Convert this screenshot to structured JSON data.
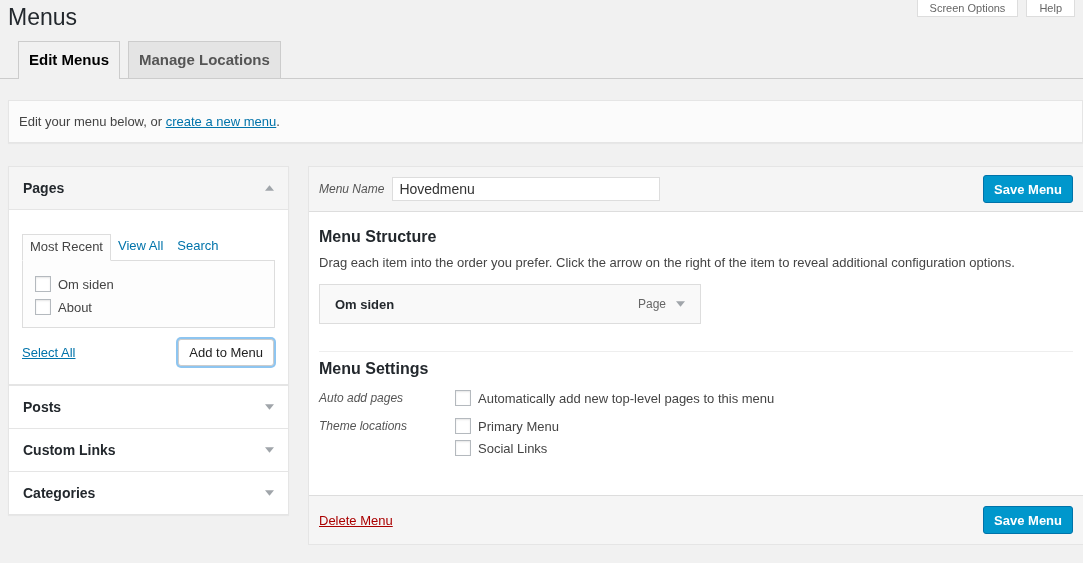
{
  "page_title": "Menus",
  "header_buttons": [
    "Screen Options",
    "Help"
  ],
  "tabs": [
    {
      "label": "Edit Menus",
      "selected": true
    },
    {
      "label": "Manage Locations",
      "selected": false
    }
  ],
  "notice": {
    "text": "Edit your menu below, or ",
    "link": "create a new menu",
    "end": "."
  },
  "sidebar": [
    {
      "title": "Pages",
      "expanded": true,
      "tabs": [
        {
          "label": "Most Recent",
          "selected": true
        },
        {
          "label": "View All",
          "selected": false
        },
        {
          "label": "Search",
          "selected": false
        }
      ],
      "items": [
        {
          "label": "Om siden",
          "checked": false
        },
        {
          "label": "About",
          "checked": false
        }
      ],
      "select_all": "Select All",
      "add_button": "Add to Menu"
    },
    {
      "title": "Posts",
      "expanded": false
    },
    {
      "title": "Custom Links",
      "expanded": false
    },
    {
      "title": "Categories",
      "expanded": false
    }
  ],
  "menu": {
    "name_label": "Menu Name",
    "name_value": "Hovedmenu",
    "save_button": "Save Menu",
    "structure_title": "Menu Structure",
    "structure_help": "Drag each item into the order you prefer. Click the arrow on the right of the item to reveal additional configuration options.",
    "items": [
      {
        "title": "Om siden",
        "type": "Page"
      }
    ],
    "settings_title": "Menu Settings",
    "settings": [
      {
        "label": "Auto add pages",
        "options": [
          {
            "label": "Automatically add new top-level pages to this menu",
            "checked": false
          }
        ]
      },
      {
        "label": "Theme locations",
        "options": [
          {
            "label": "Primary Menu",
            "checked": false
          },
          {
            "label": "Social Links",
            "checked": false
          }
        ]
      }
    ],
    "delete_link": "Delete Menu",
    "footer_save_button": "Save Menu"
  }
}
